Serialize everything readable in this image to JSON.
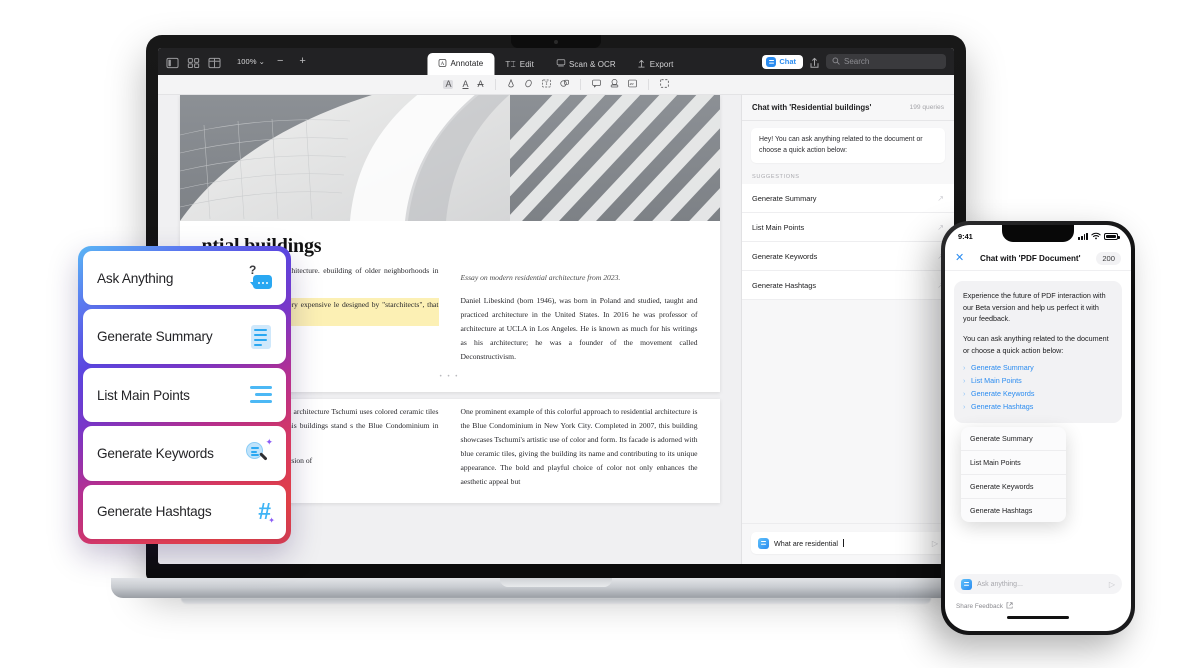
{
  "app": {
    "topbar": {
      "zoom_level": "100%",
      "zoom_out": "−",
      "zoom_in": "+",
      "tabs": [
        {
          "label": "Annotate",
          "icon": "annotate-icon",
          "active": true
        },
        {
          "label": "Edit",
          "icon": "edit-text-icon",
          "active": false
        },
        {
          "label": "Scan & OCR",
          "icon": "scan-icon",
          "active": false
        },
        {
          "label": "Export",
          "icon": "export-icon",
          "active": false
        }
      ],
      "chat_button": "Chat",
      "search_placeholder": "Search",
      "left_icons": [
        "sidebar-toggle-icon",
        "thumbnail-grid-icon",
        "page-layout-icon"
      ]
    },
    "annotate_toolbar": {
      "icons": [
        "highlight-icon",
        "underline-icon",
        "strikethrough-icon",
        "pen-icon",
        "eraser-icon",
        "text-box-icon",
        "shape-icon",
        "comment-icon",
        "stamp-icon",
        "signature-icon",
        "select-area-icon"
      ]
    }
  },
  "document": {
    "title": "ntial buildings",
    "subtitle": "Essay on modern residential architecture from 2023.",
    "left_col_p1": "contemporary residential architecture. ebuilding of older neighborhoods in large",
    "left_col_p1_hl": "condominium tower, with very expensive le designed by \"starchitects\", that is, ous architects.",
    "right_col_p1": "Daniel Libeskind (born 1946), was born in Poland and studied, taught and practiced architecture in the United States. In 2016 he was professor of architecture at UCLA in Los Angeles. He is known as much for his writings as his architecture; he was a founder of the movement called Deconstructivism.",
    "page_sep": "• • •",
    "left_col_p2": "e of contemporary residential architecture Tschumi uses colored ceramic tiles on unusual forms to make his buildings stand s the Blue Condominium in New York",
    "left_col_p3": "porary tendency is the conversion of",
    "right_col_p2": "One prominent example of this colorful approach to residential architecture is the Blue Condominium in New York City. Completed in 2007, this building showcases Tschumi's artistic use of color and form. Its facade is adorned with blue ceramic tiles, giving the building its name and contributing to its unique appearance. The bold and playful choice of color not only enhances the aesthetic appeal but"
  },
  "chat_panel": {
    "title": "Chat with 'Residential buildings'",
    "query_count": "199 queries",
    "greeting": "Hey! You can ask anything related to the document or choose a quick action below:",
    "suggestions_label": "SUGGESTIONS",
    "suggestions": [
      "Generate Summary",
      "List Main Points",
      "Generate Keywords",
      "Generate Hashtags"
    ],
    "input_value": "What are residential",
    "send_icon": "send-icon"
  },
  "phone": {
    "status": {
      "time": "9:41",
      "signal": "cellular-icon",
      "wifi": "wifi-icon",
      "battery": "battery-icon"
    },
    "header": {
      "close": "✕",
      "title": "Chat with 'PDF Document'",
      "count": "200"
    },
    "bubble_p1": "Experience the future of PDF interaction with our Beta version and help us perfect it with your feedback.",
    "bubble_p2": "You can ask anything related to the document or choose a quick action below:",
    "links": [
      "Generate Summary",
      "List Main Points",
      "Generate Keywords",
      "Generate Hashtags"
    ],
    "suggestion_popup": [
      "Generate Summary",
      "List Main Points",
      "Generate Keywords",
      "Generate Hashtags"
    ],
    "input_placeholder": "Ask anything...",
    "feedback_label": "Share Feedback",
    "feedback_icon": "external-link-icon"
  },
  "quick_actions": {
    "cards": [
      {
        "label": "Ask Anything",
        "icon": "question-chat-bubble-icon"
      },
      {
        "label": "Generate Summary",
        "icon": "document-lines-icon"
      },
      {
        "label": "List Main Points",
        "icon": "bullet-lines-icon"
      },
      {
        "label": "Generate Keywords",
        "icon": "magnifier-sparkle-icon"
      },
      {
        "label": "Generate Hashtags",
        "icon": "hashtag-sparkle-icon"
      }
    ],
    "gradient": {
      "from": "#5ab6f5",
      "mid1": "#5b46e0",
      "mid2": "#b72f8f",
      "to": "#e03f46"
    }
  },
  "colors": {
    "accent_blue": "#2b8cf0",
    "icon_blue": "#3fb4f5",
    "sparkle_purple": "#8b5cf6",
    "highlight_yellow": "#fcf0b4",
    "toolbar_dark": "#222224"
  }
}
